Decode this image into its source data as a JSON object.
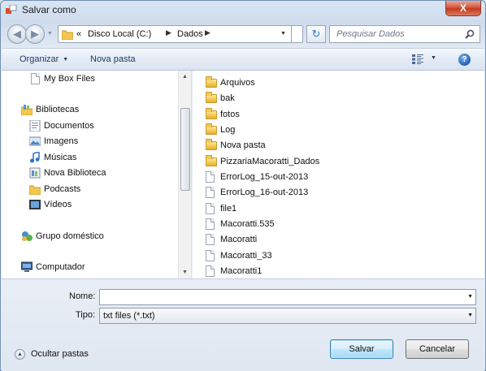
{
  "window": {
    "title": "Salvar como",
    "close_label": "X"
  },
  "navbar": {
    "address": [
      "«",
      "Disco Local (C:)",
      "Dados"
    ],
    "search_placeholder": "Pesquisar Dados"
  },
  "toolbar": {
    "organize": "Organizar",
    "new_folder": "Nova pasta"
  },
  "nav_pane": {
    "items": [
      {
        "label": "My Box Files",
        "icon": "file-icon"
      },
      {
        "label": "Bibliotecas",
        "icon": "libraries-icon"
      },
      {
        "label": "Documentos",
        "icon": "documents-icon"
      },
      {
        "label": "Imagens",
        "icon": "pictures-icon"
      },
      {
        "label": "Músicas",
        "icon": "music-icon"
      },
      {
        "label": "Nova Biblioteca",
        "icon": "library-icon"
      },
      {
        "label": "Podcasts",
        "icon": "podcasts-icon"
      },
      {
        "label": "Vídeos",
        "icon": "videos-icon"
      },
      {
        "label": "Grupo doméstico",
        "icon": "homegroup-icon"
      },
      {
        "label": "Computador",
        "icon": "computer-icon"
      }
    ]
  },
  "files": [
    {
      "name": "Arquivos",
      "type": "folder"
    },
    {
      "name": "bak",
      "type": "folder"
    },
    {
      "name": "fotos",
      "type": "folder"
    },
    {
      "name": "Log",
      "type": "folder"
    },
    {
      "name": "Nova pasta",
      "type": "folder"
    },
    {
      "name": "PizzariaMacoratti_Dados",
      "type": "folder"
    },
    {
      "name": "ErrorLog_15-out-2013",
      "type": "file"
    },
    {
      "name": "ErrorLog_16-out-2013",
      "type": "file"
    },
    {
      "name": "file1",
      "type": "file"
    },
    {
      "name": "Macoratti.535",
      "type": "file"
    },
    {
      "name": "Macoratti",
      "type": "file"
    },
    {
      "name": "Macoratti_33",
      "type": "file"
    },
    {
      "name": "Macoratti1",
      "type": "file"
    }
  ],
  "form": {
    "name_label": "Nome:",
    "name_value": "",
    "type_label": "Tipo:",
    "type_value": "txt files (*.txt)",
    "hide_folders": "Ocultar pastas",
    "save_label": "Salvar",
    "cancel_label": "Cancelar"
  },
  "colors": {
    "accent": "#3c7fb1",
    "folder": "#f3c650",
    "close": "#c43c22"
  }
}
